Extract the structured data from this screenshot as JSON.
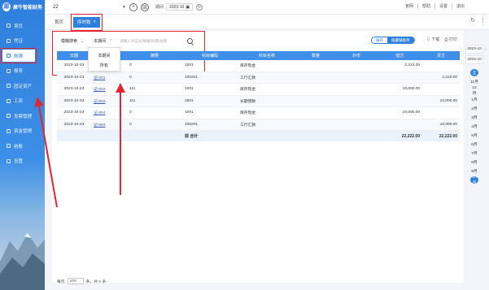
{
  "app": {
    "logo_text": "犀牛智能财务",
    "logo_letter": "犀"
  },
  "topbar": {
    "account_id": "22",
    "period_label": "期间",
    "period_value": "2023-10",
    "right_links": [
      "官网",
      "帮助",
      "设置",
      "退出"
    ]
  },
  "sidebar": {
    "items": [
      {
        "label": "首页"
      },
      {
        "label": "凭证"
      },
      {
        "label": "账簿"
      },
      {
        "label": "报表"
      },
      {
        "label": "固定资产"
      },
      {
        "label": "工资"
      },
      {
        "label": "发票管理"
      },
      {
        "label": "资金管理"
      },
      {
        "label": "结账"
      },
      {
        "label": "设置"
      }
    ]
  },
  "tabs": {
    "home": "首页",
    "active": "序时账",
    "close": "×"
  },
  "filter": {
    "mode_label": "模糊搜索",
    "period_label": "本期间",
    "search_placeholder": "请输入凭证号/摘要/科目/金额",
    "dropdown_options": [
      "本期间",
      "所有"
    ]
  },
  "toggle": {
    "off": "展开",
    "on": "隐藏辅助项"
  },
  "actions": {
    "download": "下载",
    "print": "打印"
  },
  "table": {
    "columns": [
      "日期",
      "凭证号",
      "摘要",
      "科目编码",
      "科目名称",
      "数量",
      "外币",
      "借方",
      "贷方"
    ],
    "rows": [
      [
        "2023-10-23",
        "记-001",
        "0",
        "1001",
        "库存现金",
        "",
        "",
        "2,222.00",
        ""
      ],
      [
        "2023-10-23",
        "记-001",
        "0",
        "100201",
        "工行汇款",
        "",
        "",
        "",
        "2,222.00"
      ],
      [
        "2023-10-23",
        "记-003",
        "111",
        "1001",
        "库存现金",
        "",
        "",
        "10,000.00",
        ""
      ],
      [
        "2023-10-23",
        "记-003",
        "111",
        "2501",
        "长期借款",
        "",
        "",
        "",
        "10,000.00"
      ],
      [
        "2023-10-23",
        "记-004",
        "0",
        "1001",
        "库存现金",
        "",
        "",
        "10,000.00",
        ""
      ],
      [
        "2023-10-23",
        "记-004",
        "0",
        "100201",
        "工行汇款",
        "",
        "",
        "",
        "10,000.00"
      ]
    ],
    "total_label": "合计",
    "total_debit": "22,222.00",
    "total_credit": "22,222.00"
  },
  "rail": {
    "years": [
      "2023-10",
      "2023-10"
    ],
    "all_label": "全",
    "months": [
      "11月",
      "12月",
      "1月",
      "2月",
      "3月",
      "4月",
      "5月",
      "6月",
      "7月",
      "8月",
      "9月",
      "10月"
    ],
    "current_month": "10月"
  },
  "footer": {
    "per_page_label": "每页",
    "per_page_value": "100",
    "summary": "条，共 6 条"
  },
  "colors": {
    "accent": "#2f7fdd",
    "annotation": "#e0262f"
  }
}
